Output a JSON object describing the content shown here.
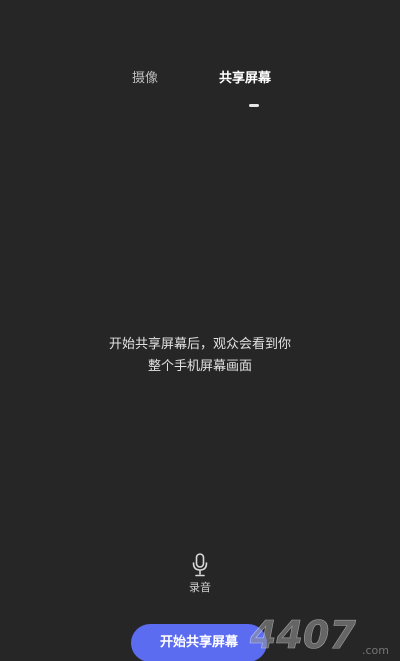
{
  "tabs": [
    {
      "label": "摄像",
      "active": false
    },
    {
      "label": "共享屏幕",
      "active": true
    }
  ],
  "message": {
    "line1": "开始共享屏幕后，观众会看到你",
    "line2": "整个手机屏幕画面"
  },
  "record": {
    "label": "录音",
    "icon": "microphone-icon"
  },
  "start_button": {
    "label": "开始共享屏幕",
    "color": "#5b6cf0"
  },
  "watermark": {
    "text": "4407",
    "suffix": ".com"
  },
  "colors": {
    "background": "#262626",
    "accent": "#5b6cf0"
  }
}
